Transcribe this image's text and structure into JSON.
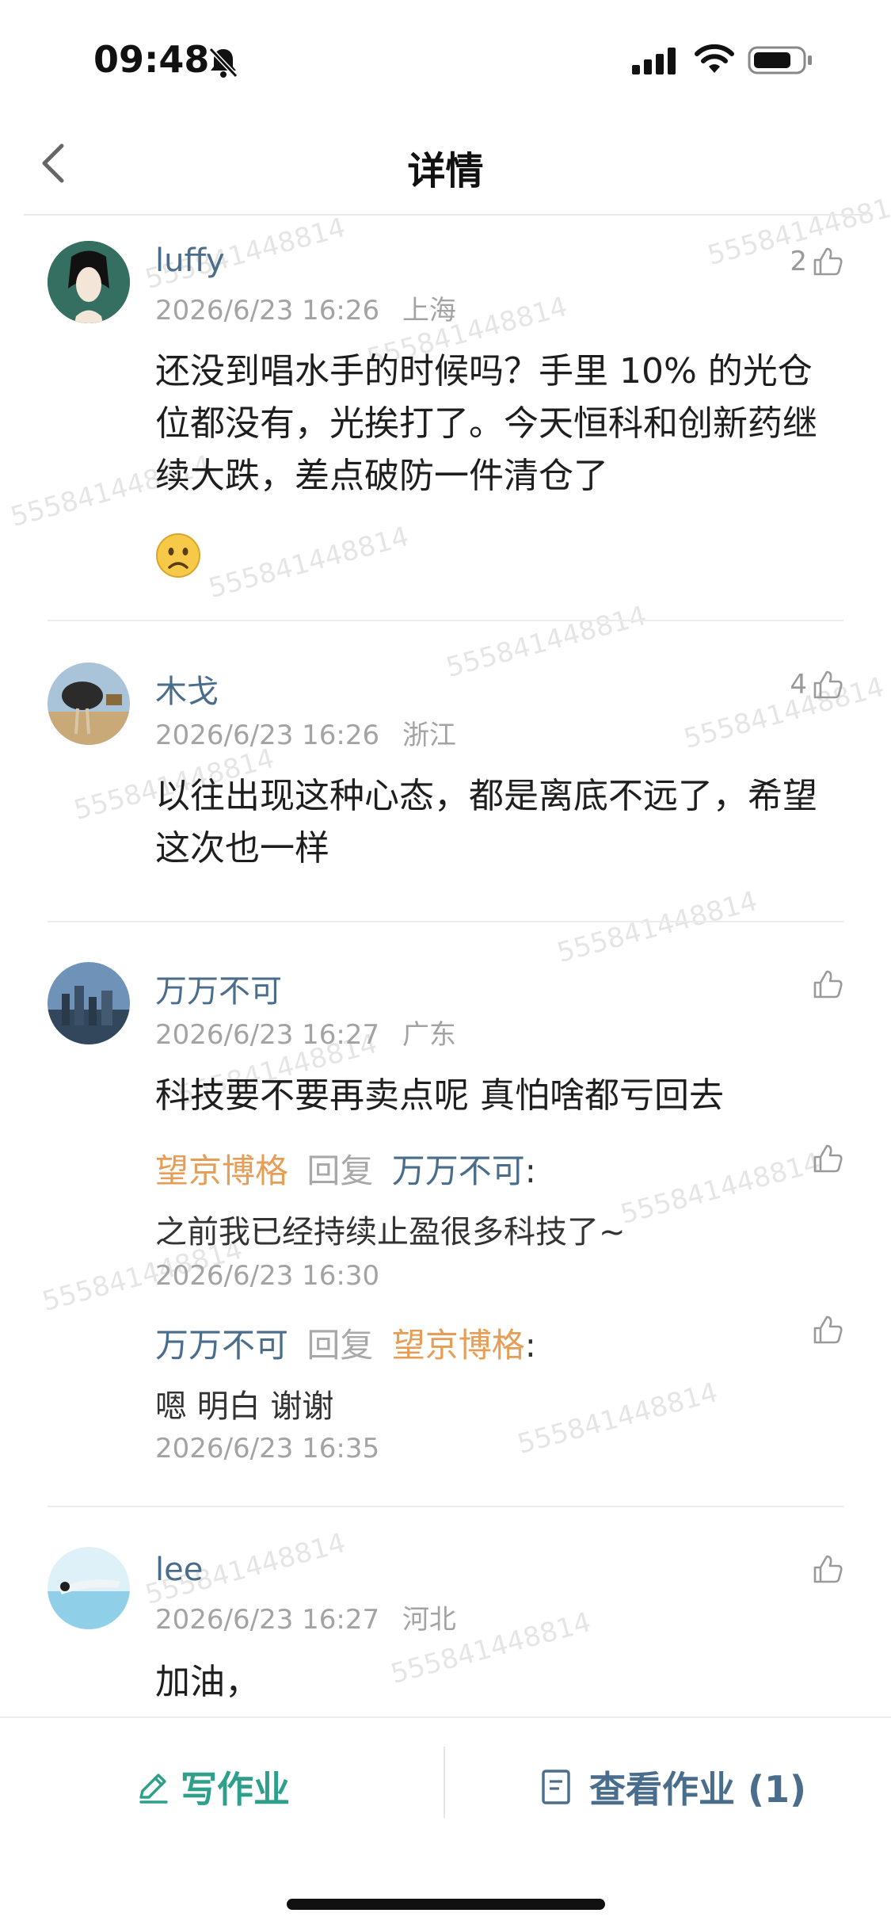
{
  "status_bar": {
    "time": "09:48"
  },
  "nav": {
    "title": "详情"
  },
  "comments": [
    {
      "name": "luffy",
      "date": "2026/6/23 16:26",
      "location": "上海",
      "likes": "2",
      "content": "还没到唱水手的时候吗？手里 10% 的光仓位都没有，光挨打了。今天恒科和创新药继续大跌，差点破防一件清仓了"
    },
    {
      "name": "木戈",
      "date": "2026/6/23 16:26",
      "location": "浙江",
      "likes": "4",
      "content": "以往出现这种心态，都是离底不远了，希望这次也一样"
    },
    {
      "name": "万万不可",
      "date": "2026/6/23 16:27",
      "location": "广东",
      "likes": "",
      "content": "科技要不要再卖点呢 真怕啥都亏回去",
      "replies": [
        {
          "from": "望京博格",
          "verb": "回复",
          "to": "万万不可",
          "colon": ":",
          "content": "之前我已经持续止盈很多科技了~",
          "date": "2026/6/23 16:30"
        },
        {
          "from": "万万不可",
          "verb": "回复",
          "to": "望京博格",
          "colon": ":",
          "content": "嗯 明白 谢谢",
          "date": "2026/6/23 16:35"
        }
      ]
    },
    {
      "name": "lee",
      "date": "2026/6/23 16:27",
      "location": "河北",
      "likes": "",
      "content": "加油，"
    }
  ],
  "bottom_bar": {
    "write_label": "写作业",
    "view_label": "查看作业 (1)"
  },
  "watermark": "555841448814",
  "colors": {
    "accent_green": "#2d9f8a",
    "name_blue": "#4a6d8c",
    "reply_orange": "#e69d55"
  },
  "icons": [
    "bell-slash-icon",
    "signal-icon",
    "wifi-icon",
    "battery-icon",
    "back-chevron-icon",
    "thumbs-up-icon",
    "pencil-icon",
    "document-icon",
    "emoji-frown-icon"
  ]
}
